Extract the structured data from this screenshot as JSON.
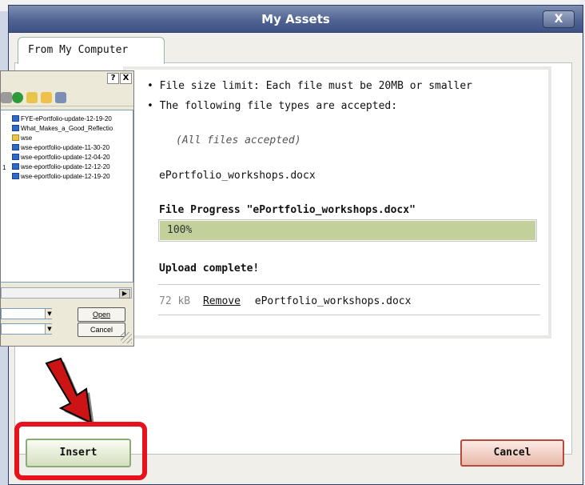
{
  "dialog": {
    "title": "My Assets",
    "close_label": "X",
    "tab_label": "From My Computer"
  },
  "info": {
    "size_limit": "• File size limit: Each file must be 20MB or smaller",
    "types_accepted": "• The following file types are accepted:",
    "all_files": "(All files accepted)",
    "selected_file": "ePortfolio_workshops.docx"
  },
  "progress": {
    "title": "File Progress \"ePortfolio_workshops.docx\"",
    "percent_label": "100%",
    "value": 1.0,
    "color": "#c3d09b"
  },
  "status": {
    "message": "Upload complete!"
  },
  "uploaded_file": {
    "size": "72 kB",
    "remove_label": "Remove",
    "name": "ePortfolio_workshops.docx"
  },
  "buttons": {
    "insert_label": "Insert",
    "cancel_label": "Cancel"
  },
  "file_dialog": {
    "help_label": "?",
    "close_label": "X",
    "items": [
      {
        "name": "FYE-ePortfolio-update-12-19-20",
        "type": "doc"
      },
      {
        "name": "What_Makes_a_Good_Reflectio",
        "type": "doc"
      },
      {
        "name": "wse",
        "type": "folder"
      },
      {
        "name": "wse-eportfolio-update-11-30-20",
        "type": "doc"
      },
      {
        "name": "wse-eportfolio-update-12-04-20",
        "type": "doc"
      },
      {
        "name": "wse-eportfolio-update-12-12-20",
        "type": "doc"
      },
      {
        "name": "wse-eportfolio-update-12-19-20",
        "type": "doc"
      }
    ],
    "side_number": "1",
    "open_label": "Open",
    "cancel_label": "Cancel"
  },
  "colors": {
    "highlight": "#e8121e",
    "titlebar": "#4f6493"
  }
}
